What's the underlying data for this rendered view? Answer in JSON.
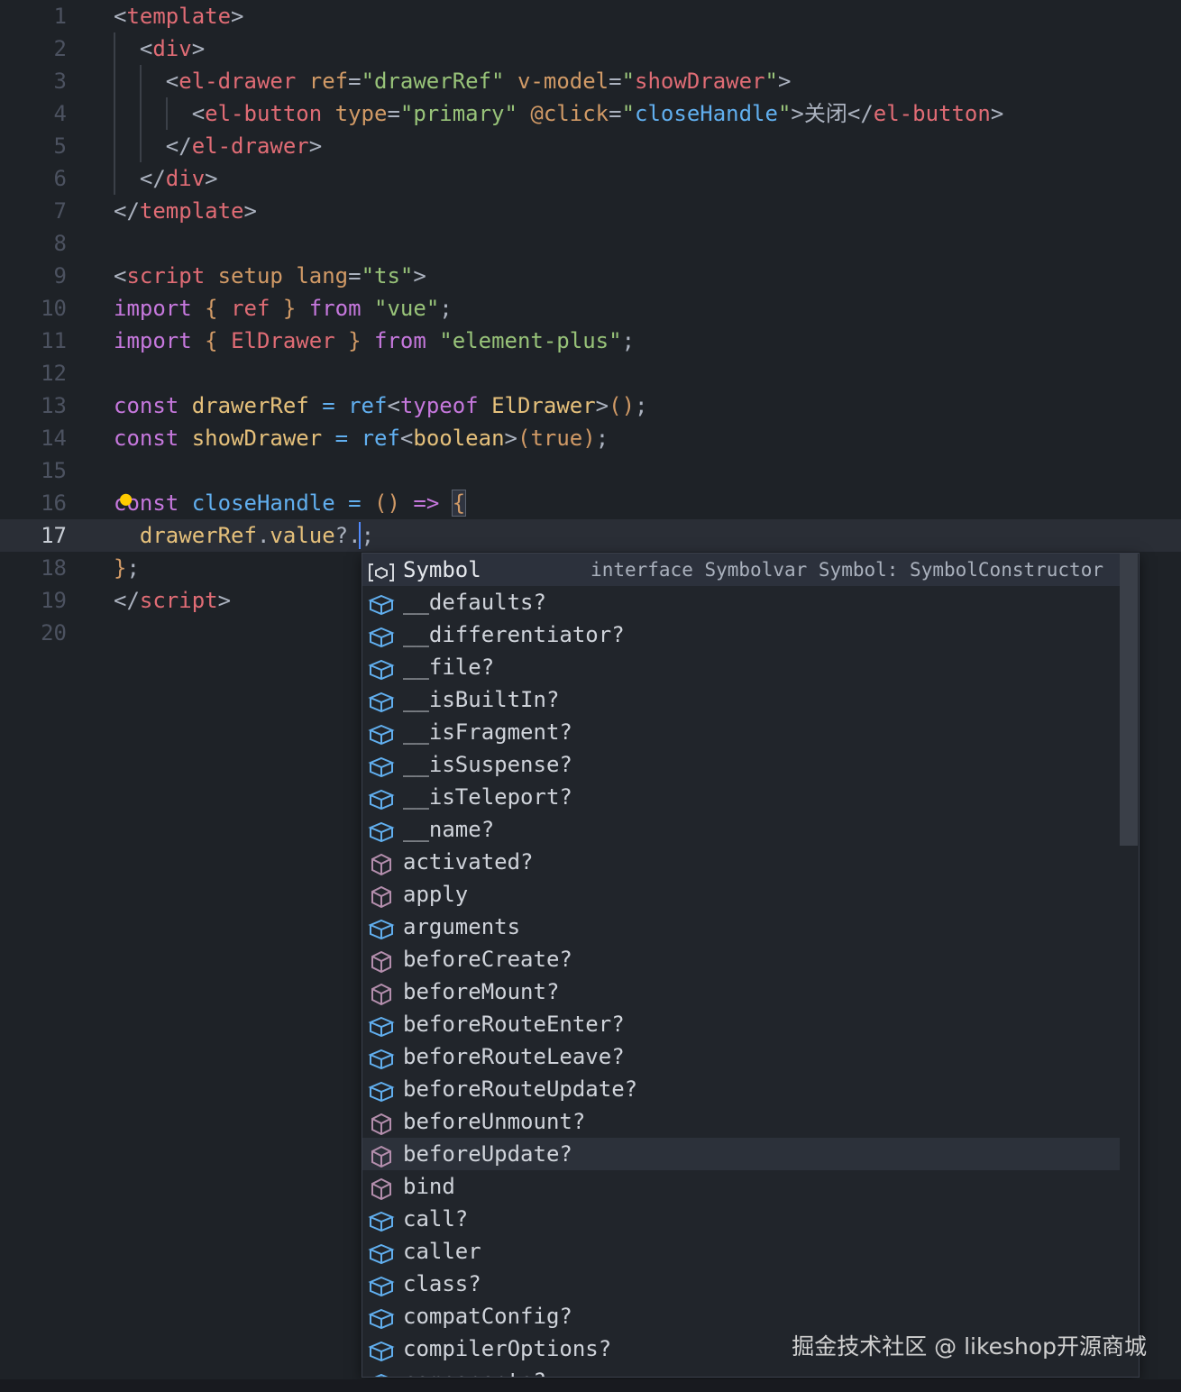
{
  "editor": {
    "current_line": 17,
    "lines": [
      {
        "n": "1",
        "tokens": [
          [
            "<",
            "t-punct"
          ],
          [
            "template",
            "t-tag"
          ],
          [
            ">",
            "t-punct"
          ]
        ]
      },
      {
        "n": "2",
        "tokens": [
          [
            "  <",
            "t-punct"
          ],
          [
            "div",
            "t-tag"
          ],
          [
            ">",
            "t-punct"
          ]
        ]
      },
      {
        "n": "3",
        "tokens": [
          [
            "    <",
            "t-punct"
          ],
          [
            "el-drawer",
            "t-tag"
          ],
          [
            " ",
            "t-text"
          ],
          [
            "ref",
            "t-attr"
          ],
          [
            "=",
            "t-punct"
          ],
          [
            "\"drawerRef\"",
            "t-str"
          ],
          [
            " ",
            "t-text"
          ],
          [
            "v-model",
            "t-attr"
          ],
          [
            "=",
            "t-punct"
          ],
          [
            "\"",
            "t-str"
          ],
          [
            "showDrawer",
            "t-tag"
          ],
          [
            "\"",
            "t-str"
          ],
          [
            ">",
            "t-punct"
          ]
        ]
      },
      {
        "n": "4",
        "tokens": [
          [
            "      <",
            "t-punct"
          ],
          [
            "el-button",
            "t-tag"
          ],
          [
            " ",
            "t-text"
          ],
          [
            "type",
            "t-attr"
          ],
          [
            "=",
            "t-punct"
          ],
          [
            "\"primary\"",
            "t-str"
          ],
          [
            " ",
            "t-text"
          ],
          [
            "@click",
            "t-attr"
          ],
          [
            "=",
            "t-punct"
          ],
          [
            "\"",
            "t-str"
          ],
          [
            "closeHandle",
            "t-fn"
          ],
          [
            "\"",
            "t-str"
          ],
          [
            ">",
            "t-punct"
          ],
          [
            "关闭",
            "t-text"
          ],
          [
            "</",
            "t-punct"
          ],
          [
            "el-button",
            "t-tag"
          ],
          [
            ">",
            "t-punct"
          ]
        ]
      },
      {
        "n": "5",
        "tokens": [
          [
            "    </",
            "t-punct"
          ],
          [
            "el-drawer",
            "t-tag"
          ],
          [
            ">",
            "t-punct"
          ]
        ]
      },
      {
        "n": "6",
        "tokens": [
          [
            "  </",
            "t-punct"
          ],
          [
            "div",
            "t-tag"
          ],
          [
            ">",
            "t-punct"
          ]
        ]
      },
      {
        "n": "7",
        "tokens": [
          [
            "</",
            "t-punct"
          ],
          [
            "template",
            "t-tag"
          ],
          [
            ">",
            "t-punct"
          ]
        ]
      },
      {
        "n": "8",
        "tokens": []
      },
      {
        "n": "9",
        "tokens": [
          [
            "<",
            "t-punct"
          ],
          [
            "script",
            "t-tag"
          ],
          [
            " ",
            "t-text"
          ],
          [
            "setup",
            "t-attr"
          ],
          [
            " ",
            "t-text"
          ],
          [
            "lang",
            "t-attr"
          ],
          [
            "=",
            "t-punct"
          ],
          [
            "\"ts\"",
            "t-str"
          ],
          [
            ">",
            "t-punct"
          ]
        ]
      },
      {
        "n": "10",
        "tokens": [
          [
            "import",
            "t-kw"
          ],
          [
            " ",
            "t-text"
          ],
          [
            "{",
            "t-brack"
          ],
          [
            " ",
            "t-text"
          ],
          [
            "ref",
            "t-tag"
          ],
          [
            " ",
            "t-text"
          ],
          [
            "}",
            "t-brack"
          ],
          [
            " ",
            "t-text"
          ],
          [
            "from",
            "t-kw"
          ],
          [
            " ",
            "t-text"
          ],
          [
            "\"vue\"",
            "t-str"
          ],
          [
            ";",
            "t-punct"
          ]
        ]
      },
      {
        "n": "11",
        "tokens": [
          [
            "import",
            "t-kw"
          ],
          [
            " ",
            "t-text"
          ],
          [
            "{",
            "t-brack"
          ],
          [
            " ",
            "t-text"
          ],
          [
            "ElDrawer",
            "t-tag"
          ],
          [
            " ",
            "t-text"
          ],
          [
            "}",
            "t-brack"
          ],
          [
            " ",
            "t-text"
          ],
          [
            "from",
            "t-kw"
          ],
          [
            " ",
            "t-text"
          ],
          [
            "\"element-plus\"",
            "t-str"
          ],
          [
            ";",
            "t-punct"
          ]
        ]
      },
      {
        "n": "12",
        "tokens": []
      },
      {
        "n": "13",
        "tokens": [
          [
            "const",
            "t-kw"
          ],
          [
            " ",
            "t-text"
          ],
          [
            "drawerRef",
            "t-var"
          ],
          [
            " ",
            "t-text"
          ],
          [
            "=",
            "t-fn"
          ],
          [
            " ",
            "t-text"
          ],
          [
            "ref",
            "t-fn"
          ],
          [
            "<",
            "t-punct"
          ],
          [
            "typeof",
            "t-kw"
          ],
          [
            " ",
            "t-text"
          ],
          [
            "ElDrawer",
            "t-var"
          ],
          [
            ">",
            "t-punct"
          ],
          [
            "()",
            "t-brack"
          ],
          [
            ";",
            "t-punct"
          ]
        ]
      },
      {
        "n": "14",
        "tokens": [
          [
            "const",
            "t-kw"
          ],
          [
            " ",
            "t-text"
          ],
          [
            "showDrawer",
            "t-var"
          ],
          [
            " ",
            "t-text"
          ],
          [
            "=",
            "t-fn"
          ],
          [
            " ",
            "t-text"
          ],
          [
            "ref",
            "t-fn"
          ],
          [
            "<",
            "t-punct"
          ],
          [
            "boolean",
            "t-var"
          ],
          [
            ">",
            "t-punct"
          ],
          [
            "(",
            "t-brack"
          ],
          [
            "true",
            "t-attr"
          ],
          [
            ")",
            "t-brack"
          ],
          [
            ";",
            "t-punct"
          ]
        ]
      },
      {
        "n": "15",
        "tokens": []
      },
      {
        "n": "16",
        "tokens": [
          [
            "co",
            "t-kw"
          ],
          [
            "nst",
            "t-kw"
          ],
          [
            " ",
            "t-text"
          ],
          [
            "closeHandle",
            "t-fn"
          ],
          [
            " ",
            "t-text"
          ],
          [
            "=",
            "t-fn"
          ],
          [
            " ",
            "t-text"
          ],
          [
            "()",
            "t-brack"
          ],
          [
            " ",
            "t-text"
          ],
          [
            "=>",
            "t-kw"
          ],
          [
            " ",
            "t-text"
          ],
          [
            "{",
            "t-brack"
          ]
        ]
      },
      {
        "n": "17",
        "tokens": [
          [
            "  ",
            "t-text"
          ],
          [
            "drawerRef",
            "t-var"
          ],
          [
            ".",
            "t-punct"
          ],
          [
            "value",
            "t-var"
          ],
          [
            "?.",
            "t-punct"
          ],
          [
            ";",
            "t-punct"
          ]
        ]
      },
      {
        "n": "18",
        "tokens": [
          [
            "}",
            "t-brack"
          ],
          [
            ";",
            "t-punct"
          ]
        ]
      },
      {
        "n": "19",
        "tokens": [
          [
            "</",
            "t-punct"
          ],
          [
            "script",
            "t-tag"
          ],
          [
            ">",
            "t-punct"
          ]
        ]
      },
      {
        "n": "20",
        "tokens": []
      }
    ]
  },
  "suggest": {
    "selected_index": 0,
    "focused_index": 18,
    "selected_detail": "interface Symbolvar Symbol: SymbolConstructor",
    "colors": {
      "blue": "#61afef",
      "purple": "#b48ead"
    },
    "items": [
      {
        "label": "Symbol",
        "kind": "variable-icon",
        "color": "#d4d7dc"
      },
      {
        "label": "__defaults?",
        "kind": "field-icon",
        "color": "#61afef"
      },
      {
        "label": "__differentiator?",
        "kind": "field-icon",
        "color": "#61afef"
      },
      {
        "label": "__file?",
        "kind": "field-icon",
        "color": "#61afef"
      },
      {
        "label": "__isBuiltIn?",
        "kind": "field-icon",
        "color": "#61afef"
      },
      {
        "label": "__isFragment?",
        "kind": "field-icon",
        "color": "#61afef"
      },
      {
        "label": "__isSuspense?",
        "kind": "field-icon",
        "color": "#61afef"
      },
      {
        "label": "__isTeleport?",
        "kind": "field-icon",
        "color": "#61afef"
      },
      {
        "label": "__name?",
        "kind": "field-icon",
        "color": "#61afef"
      },
      {
        "label": "activated?",
        "kind": "method-icon",
        "color": "#b48ead"
      },
      {
        "label": "apply",
        "kind": "method-icon",
        "color": "#b48ead"
      },
      {
        "label": "arguments",
        "kind": "field-icon",
        "color": "#61afef"
      },
      {
        "label": "beforeCreate?",
        "kind": "method-icon",
        "color": "#b48ead"
      },
      {
        "label": "beforeMount?",
        "kind": "method-icon",
        "color": "#b48ead"
      },
      {
        "label": "beforeRouteEnter?",
        "kind": "field-icon",
        "color": "#61afef"
      },
      {
        "label": "beforeRouteLeave?",
        "kind": "field-icon",
        "color": "#61afef"
      },
      {
        "label": "beforeRouteUpdate?",
        "kind": "field-icon",
        "color": "#61afef"
      },
      {
        "label": "beforeUnmount?",
        "kind": "method-icon",
        "color": "#b48ead"
      },
      {
        "label": "beforeUpdate?",
        "kind": "method-icon",
        "color": "#b48ead"
      },
      {
        "label": "bind",
        "kind": "method-icon",
        "color": "#b48ead"
      },
      {
        "label": "call?",
        "kind": "field-icon",
        "color": "#61afef"
      },
      {
        "label": "caller",
        "kind": "field-icon",
        "color": "#61afef"
      },
      {
        "label": "class?",
        "kind": "field-icon",
        "color": "#61afef"
      },
      {
        "label": "compatConfig?",
        "kind": "field-icon",
        "color": "#61afef"
      },
      {
        "label": "compilerOptions?",
        "kind": "field-icon",
        "color": "#61afef"
      },
      {
        "label": "components?",
        "kind": "field-icon",
        "color": "#61afef"
      }
    ]
  },
  "watermark": "掘金技术社区 @ likeshop开源商城"
}
